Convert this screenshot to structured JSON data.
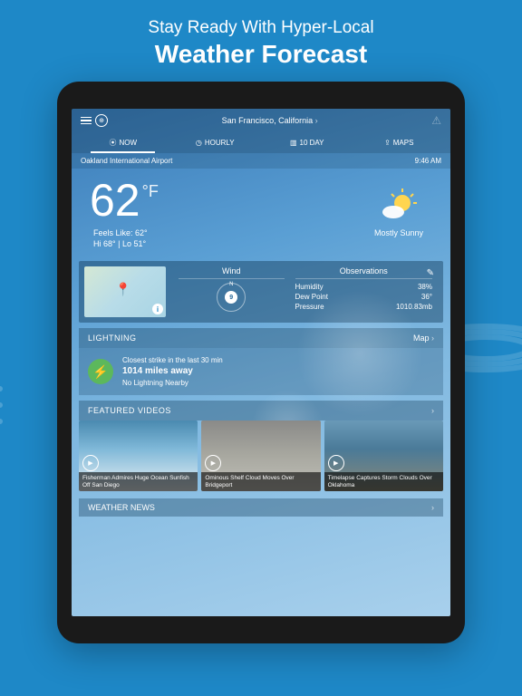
{
  "promo": {
    "subtitle": "Stay Ready With Hyper-Local",
    "title": "Weather Forecast"
  },
  "header": {
    "location": "San Francisco, California"
  },
  "tabs": [
    {
      "icon": "⦿",
      "label": "NOW",
      "active": true
    },
    {
      "icon": "◷",
      "label": "HOURLY",
      "active": false
    },
    {
      "icon": "▥",
      "label": "10 DAY",
      "active": false
    },
    {
      "icon": "⇪",
      "label": "MAPS",
      "active": false
    }
  ],
  "status": {
    "station": "Oakland International Airport",
    "time": "9:46 AM"
  },
  "current": {
    "temp": "62",
    "unit": "°F",
    "feels_label": "Feels Like:",
    "feels_value": "62°",
    "hi_label": "Hi",
    "hi_value": "68°",
    "lo_label": "Lo",
    "lo_value": "51°",
    "condition": "Mostly Sunny"
  },
  "details": {
    "wind_label": "Wind",
    "wind_speed": "9",
    "wind_dir": "N",
    "obs_label": "Observations",
    "observations": [
      {
        "label": "Humidity",
        "value": "38%"
      },
      {
        "label": "Dew Point",
        "value": "36°"
      },
      {
        "label": "Pressure",
        "value": "1010.83mb"
      }
    ]
  },
  "lightning": {
    "header": "LIGHTNING",
    "map_link": "Map",
    "line1": "Closest strike in the last 30 min",
    "distance": "1014 miles away",
    "line3": "No Lightning Nearby"
  },
  "featured": {
    "header": "FEATURED VIDEOS",
    "videos": [
      {
        "caption": "Fisherman Admires Huge Ocean Sunfish Off San Diego"
      },
      {
        "caption": "Ominous Shelf Cloud Moves Over Bridgeport"
      },
      {
        "caption": "Timelapse Captures Storm Clouds Over Oklahoma"
      }
    ]
  },
  "news": {
    "header": "WEATHER NEWS"
  }
}
